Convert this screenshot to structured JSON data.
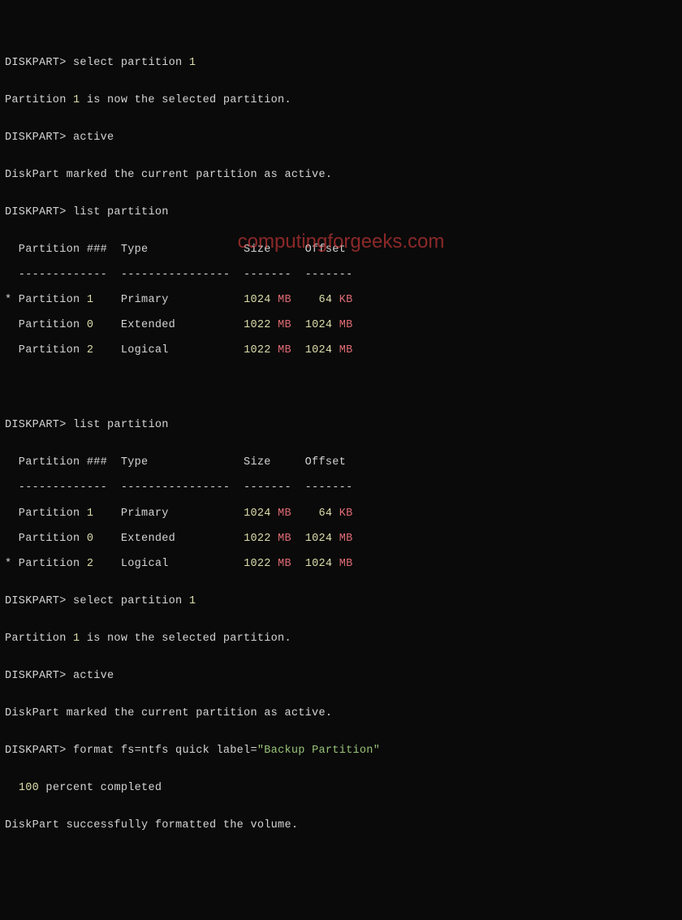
{
  "prompt": "DISKPART>",
  "watermark": "computingforgeeks.com",
  "block1": {
    "cmd1_pre": " select partition ",
    "cmd1_num": "1",
    "resp1_a": "Partition ",
    "resp1_b": "1",
    "resp1_c": " is now the selected partition.",
    "cmd2": " active",
    "resp2": "DiskPart marked the current partition as active.",
    "cmd3": " list partition",
    "hdr": "  Partition ###  Type              Size     Offset",
    "dashes": "  -------------  ----------------  -------  -------",
    "r1_a": "* Partition ",
    "r1_b": "1",
    "r1_c": "    Primary           ",
    "r1_d": "1024",
    "r1_e": " MB",
    "r1_f": "    ",
    "r1_g": "64",
    "r1_h": " KB",
    "r2_a": "  Partition ",
    "r2_b": "0",
    "r2_c": "    Extended          ",
    "r2_d": "1022",
    "r2_e": " MB",
    "r2_f": "  ",
    "r2_g": "1024",
    "r2_h": " MB",
    "r3_a": "  Partition ",
    "r3_b": "2",
    "r3_c": "    Logical           ",
    "r3_d": "1022",
    "r3_e": " MB",
    "r3_f": "  ",
    "r3_g": "1024",
    "r3_h": " MB"
  },
  "block2": {
    "cmd1": " list partition",
    "hdr": "  Partition ###  Type              Size     Offset",
    "dashes": "  -------------  ----------------  -------  -------",
    "r1_a": "  Partition ",
    "r1_b": "1",
    "r1_c": "    Primary           ",
    "r1_d": "1024",
    "r1_e": " MB",
    "r1_f": "    ",
    "r1_g": "64",
    "r1_h": " KB",
    "r2_a": "  Partition ",
    "r2_b": "0",
    "r2_c": "    Extended          ",
    "r2_d": "1022",
    "r2_e": " MB",
    "r2_f": "  ",
    "r2_g": "1024",
    "r2_h": " MB",
    "r3_a": "* Partition ",
    "r3_b": "2",
    "r3_c": "    Logical           ",
    "r3_d": "1022",
    "r3_e": " MB",
    "r3_f": "  ",
    "r3_g": "1024",
    "r3_h": " MB",
    "cmd2_pre": " select partition ",
    "cmd2_num": "1",
    "resp2_a": "Partition ",
    "resp2_b": "1",
    "resp2_c": " is now the selected partition.",
    "cmd3": " active",
    "resp3": "DiskPart marked the current partition as active.",
    "cmd4_a": " format fs=ntfs quick label=",
    "cmd4_b": "\"Backup Partition\"",
    "progress_a": "  ",
    "progress_b": "100",
    "progress_c": " percent completed",
    "resp4": "DiskPart successfully formatted the volume."
  }
}
